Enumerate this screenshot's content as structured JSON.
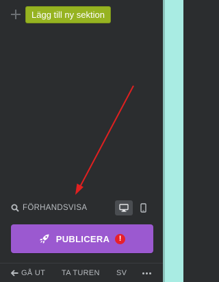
{
  "sections": {
    "add_button_label": "Lägg till ny sektion"
  },
  "preview": {
    "label": "FÖRHANDSVISA",
    "device_desktop": "desktop-icon",
    "device_mobile": "mobile-icon",
    "active_device": "desktop"
  },
  "publish": {
    "label": "PUBLICERA",
    "warning_badge": "!"
  },
  "footer": {
    "exit_label": "GÅ UT",
    "tour_label": "TA TUREN",
    "language_label": "SV"
  },
  "colors": {
    "panel_bg": "#2b2d2f",
    "add_button": "#96b321",
    "publish_button": "#9b59d0",
    "warning": "#e8202a",
    "canvas": "#a9ece3",
    "annotation_arrow": "#e02020"
  }
}
